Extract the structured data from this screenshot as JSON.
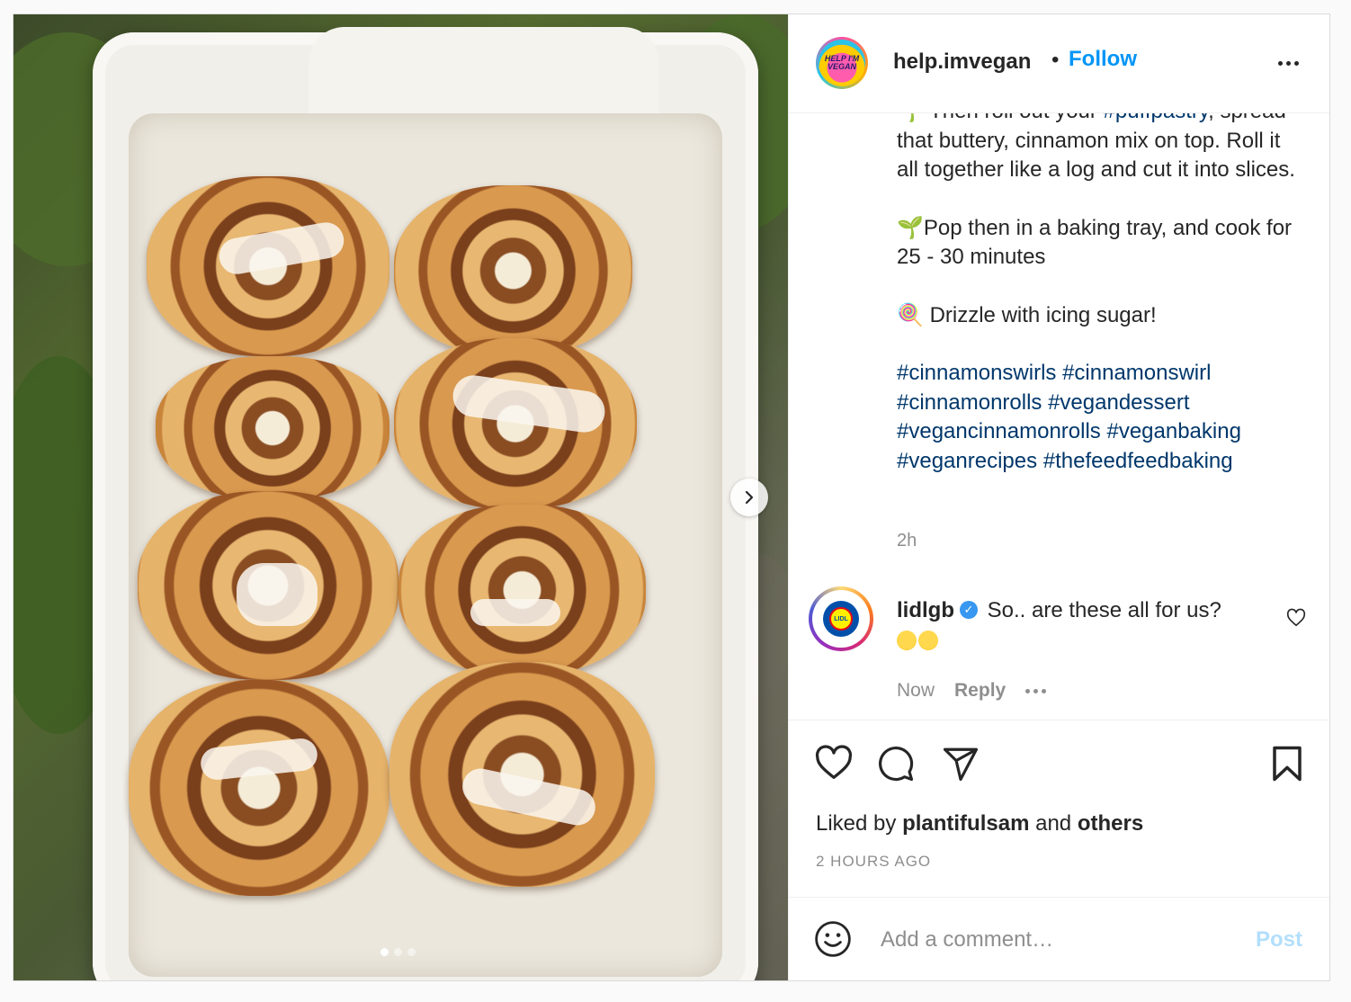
{
  "post_header": {
    "username": "help.imvegan",
    "separator": "•",
    "follow_label": "Follow",
    "avatar_text": "HELP I'M VEGAN"
  },
  "caption": {
    "partial_line_prefix": "Then roll out your ",
    "partial_line_tag": "#puffpastry",
    "partial_line_suffix": ",",
    "line1": "spread that buttery, cinnamon mix on top. Roll it all together like a log and cut it into slices.",
    "line2": "Pop then in a baking tray, and cook for 25 - 30 minutes",
    "line3": "Drizzle with icing sugar!",
    "hashtags": "#cinnamonswirls #cinnamonswirl #cinnamonrolls #vegandessert #vegancinnamonrolls #veganbaking #veganrecipes #thefeedfeedbaking",
    "time": "2h"
  },
  "comment": {
    "username": "lidlgb",
    "avatar_text": "LIDL",
    "text": "So.. are these all for us?",
    "time": "Now",
    "reply_label": "Reply"
  },
  "likes": {
    "prefix": "Liked by ",
    "user": "plantifulsam",
    "middle": " and ",
    "others": "others"
  },
  "timestamp": "2 HOURS AGO",
  "add_comment": {
    "placeholder": "Add a comment…",
    "post_label": "Post"
  },
  "carousel": {
    "total": 3,
    "active_index": 0
  },
  "icons": {
    "more": "more-horizontal-icon",
    "heart": "heart-icon",
    "comment": "comment-bubble-icon",
    "share": "paper-plane-icon",
    "save": "bookmark-icon",
    "emoji": "smiley-icon",
    "next": "chevron-right-icon",
    "verified": "verified-badge-icon"
  },
  "colors": {
    "accent": "#0095f6",
    "hashtag": "#00376b",
    "muted": "#8e8e8e",
    "post_disabled": "#b2dffc"
  }
}
